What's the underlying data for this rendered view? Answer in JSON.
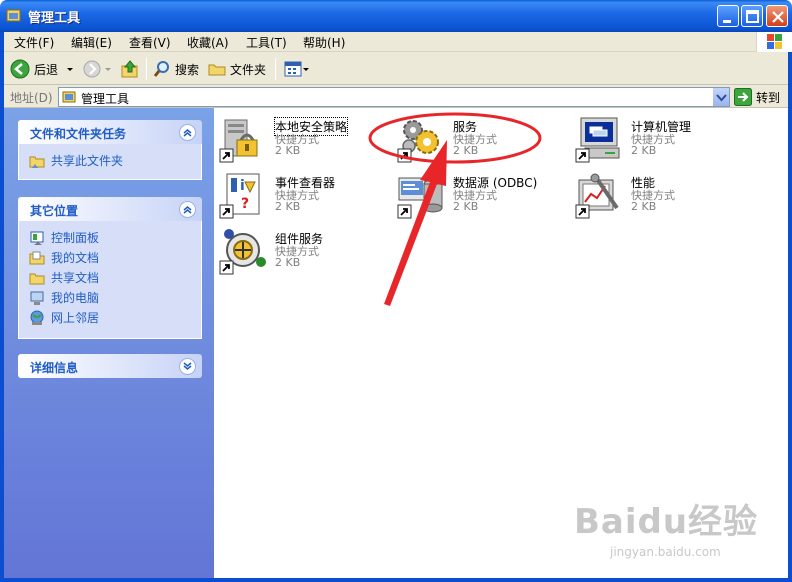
{
  "window": {
    "title": "管理工具"
  },
  "menu": [
    {
      "label": "文件(F)"
    },
    {
      "label": "编辑(E)"
    },
    {
      "label": "查看(V)"
    },
    {
      "label": "收藏(A)"
    },
    {
      "label": "工具(T)"
    },
    {
      "label": "帮助(H)"
    }
  ],
  "toolbar": {
    "back_label": "后退",
    "search_label": "搜索",
    "folders_label": "文件夹"
  },
  "address": {
    "label": "地址(D)",
    "value": "管理工具",
    "go_label": "转到"
  },
  "left_panels": [
    {
      "title": "文件和文件夹任务",
      "items": [
        {
          "label": "共享此文件夹",
          "icon": "share-folder-icon"
        }
      ]
    },
    {
      "title": "其它位置",
      "items": [
        {
          "label": "控制面板",
          "icon": "control-panel-icon"
        },
        {
          "label": "我的文档",
          "icon": "my-documents-icon"
        },
        {
          "label": "共享文档",
          "icon": "shared-documents-icon"
        },
        {
          "label": "我的电脑",
          "icon": "my-computer-icon"
        },
        {
          "label": "网上邻居",
          "icon": "network-places-icon"
        }
      ]
    },
    {
      "title": "详细信息",
      "items": []
    }
  ],
  "files": [
    {
      "name": "本地安全策略",
      "type": "快捷方式",
      "size": "2 KB",
      "icon": "local-security-policy-icon"
    },
    {
      "name": "服务",
      "type": "快捷方式",
      "size": "2 KB",
      "icon": "services-icon"
    },
    {
      "name": "计算机管理",
      "type": "快捷方式",
      "size": "2 KB",
      "icon": "computer-management-icon"
    },
    {
      "name": "事件查看器",
      "type": "快捷方式",
      "size": "2 KB",
      "icon": "event-viewer-icon"
    },
    {
      "name": "数据源 (ODBC)",
      "type": "快捷方式",
      "size": "2 KB",
      "icon": "odbc-data-source-icon"
    },
    {
      "name": "性能",
      "type": "快捷方式",
      "size": "2 KB",
      "icon": "performance-icon"
    },
    {
      "name": "组件服务",
      "type": "快捷方式",
      "size": "2 KB",
      "icon": "component-services-icon"
    }
  ],
  "watermark": {
    "brand": "Baidu经验",
    "url": "jingyan.baidu.com"
  },
  "colors": {
    "title_bar": "#0b53d0",
    "task_link": "#215dc6",
    "annotation": "#e8262a"
  }
}
